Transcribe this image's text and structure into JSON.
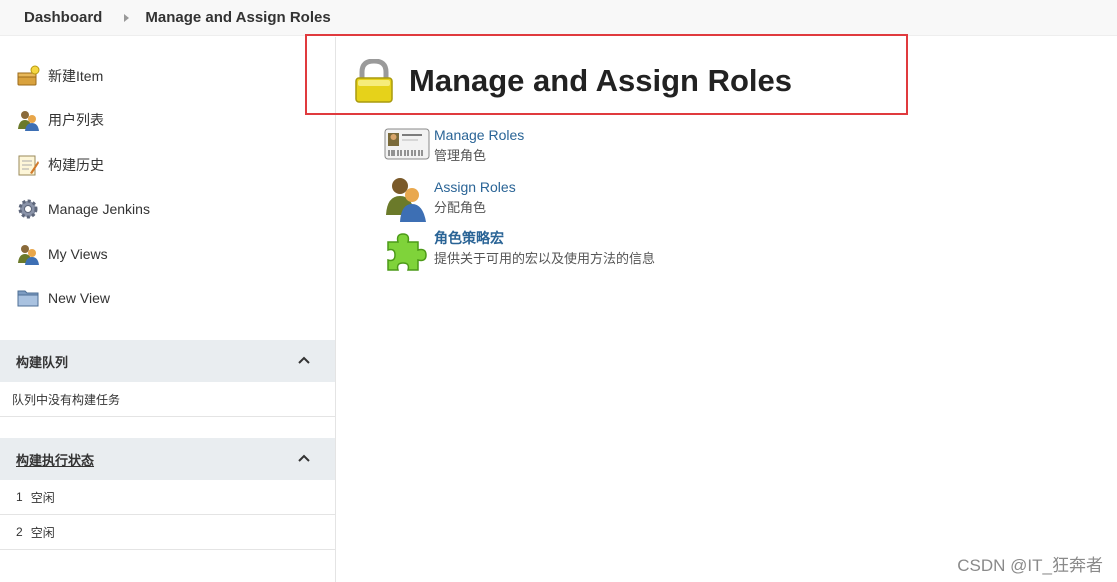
{
  "breadcrumb": {
    "items": [
      "Dashboard",
      "Manage and Assign Roles"
    ]
  },
  "sidebar": {
    "tasks": [
      {
        "label": "新建Item",
        "icon": "new-item-icon"
      },
      {
        "label": "用户列表",
        "icon": "users-icon"
      },
      {
        "label": "构建历史",
        "icon": "notepad-icon"
      },
      {
        "label": "Manage Jenkins",
        "icon": "gear-icon"
      },
      {
        "label": "My Views",
        "icon": "users-icon"
      },
      {
        "label": "New View",
        "icon": "folder-icon"
      }
    ],
    "build_queue": {
      "title": "构建队列",
      "empty_text": "队列中没有构建任务"
    },
    "executors": {
      "title": "构建执行状态",
      "rows": [
        {
          "number": "1",
          "status": "空闲"
        },
        {
          "number": "2",
          "status": "空闲"
        }
      ]
    }
  },
  "main": {
    "title": "Manage and Assign Roles",
    "items": [
      {
        "label": "Manage Roles",
        "desc": "管理角色",
        "icon": "id-card-icon"
      },
      {
        "label": "Assign Roles",
        "desc": "分配角色",
        "icon": "users-icon"
      },
      {
        "label": "角色策略宏",
        "desc": "提供关于可用的宏以及使用方法的信息",
        "icon": "puzzle-icon"
      }
    ]
  },
  "watermark": "CSDN @IT_狂奔者",
  "colors": {
    "highlight_border": "#e03a3e",
    "link": "#2a6496",
    "pane_header": "#e9edf0"
  }
}
